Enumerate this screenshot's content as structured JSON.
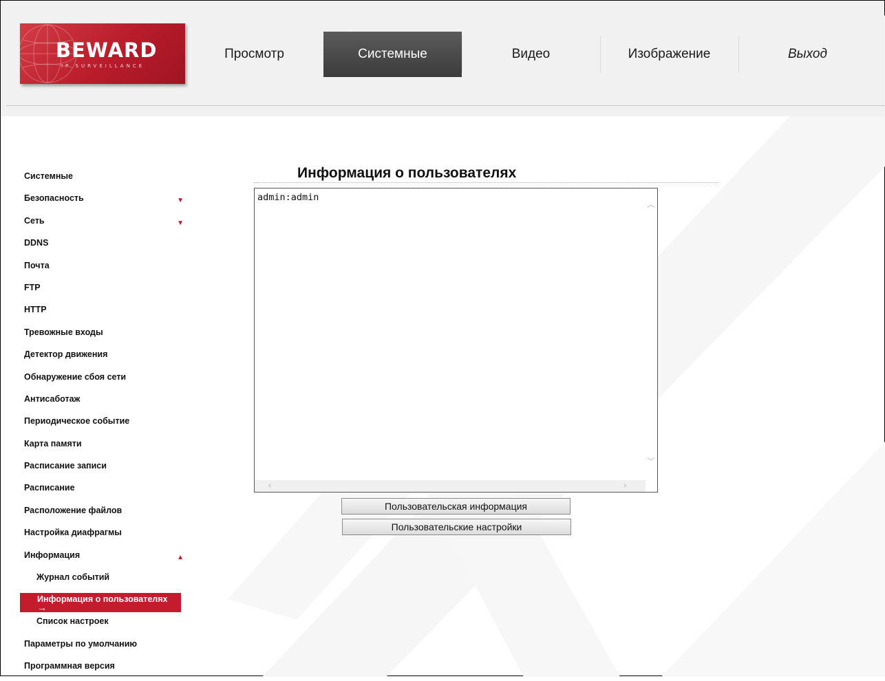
{
  "logo": {
    "brand": "BEWARD",
    "subtitle": "IP SURVEILLANCE"
  },
  "nav": {
    "tabs": [
      {
        "label": "Просмотр",
        "active": false
      },
      {
        "label": "Системные",
        "active": true
      },
      {
        "label": "Видео",
        "active": false
      },
      {
        "label": "Изображение",
        "active": false
      },
      {
        "label": "Выход",
        "active": false
      }
    ]
  },
  "sidebar": {
    "items": [
      {
        "label": "Системные"
      },
      {
        "label": "Безопасность",
        "arrow": "▼"
      },
      {
        "label": "Сеть",
        "arrow": "▼"
      },
      {
        "label": "DDNS"
      },
      {
        "label": "Почта"
      },
      {
        "label": "FTP"
      },
      {
        "label": "HTTP"
      },
      {
        "label": "Тревожные входы"
      },
      {
        "label": "Детектор движения"
      },
      {
        "label": "Обнаружение сбоя сети"
      },
      {
        "label": "Антисаботаж"
      },
      {
        "label": "Периодическое событие"
      },
      {
        "label": "Карта памяти"
      },
      {
        "label": "Расписание записи"
      },
      {
        "label": "Расписание"
      },
      {
        "label": "Расположение файлов"
      },
      {
        "label": "Настройка диафрагмы"
      },
      {
        "label": "Информация",
        "arrow": "▲"
      },
      {
        "label": "Журнал событий"
      },
      {
        "label": "Информация о пользователях",
        "pointer": "→"
      },
      {
        "label": "Список настроек"
      },
      {
        "label": "Параметры по умолчанию"
      },
      {
        "label": "Программная версия"
      }
    ]
  },
  "main": {
    "title": "Информация о пользователях",
    "textarea_value": "admin:admin",
    "buttons": {
      "user_info": "Пользовательская информация",
      "user_settings": "Пользовательские настройки"
    }
  },
  "colors": {
    "accent": "#c51c2d",
    "active_tab": "#4a4a4a",
    "header_bg": "#f1f1f1"
  }
}
